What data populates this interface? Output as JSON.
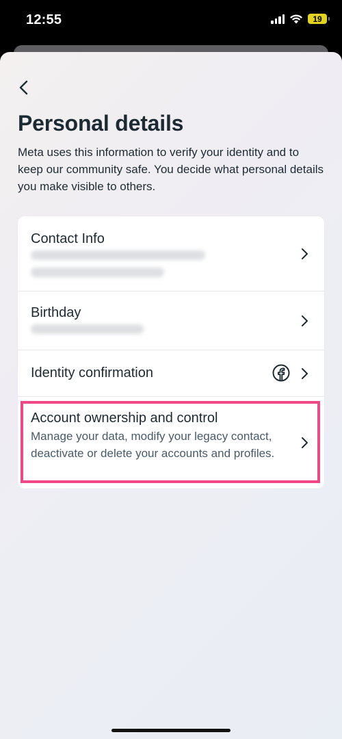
{
  "status_bar": {
    "time": "12:55",
    "battery_level": "19",
    "battery_color": "#e3d21e"
  },
  "header": {
    "back_icon": "chevron-left-icon",
    "title": "Personal details",
    "description": "Meta uses this information to verify your identity and to keep our community safe. You decide what personal details you make visible to others."
  },
  "items": [
    {
      "title": "Contact Info",
      "detail": "redacted (blurred)",
      "icon": "chevron-right-icon"
    },
    {
      "title": "Birthday",
      "detail": "redacted (blurred)",
      "icon": "chevron-right-icon"
    },
    {
      "title": "Identity confirmation",
      "badge_icon": "facebook-icon",
      "icon": "chevron-right-icon"
    },
    {
      "title": "Account ownership and control",
      "subtitle": "Manage your data, modify your legacy contact, deactivate or delete your accounts and profiles.",
      "icon": "chevron-right-icon"
    }
  ],
  "colors": {
    "highlight": "#ef4788",
    "title_text": "#1c2b33",
    "subtitle_text": "#465a69"
  }
}
